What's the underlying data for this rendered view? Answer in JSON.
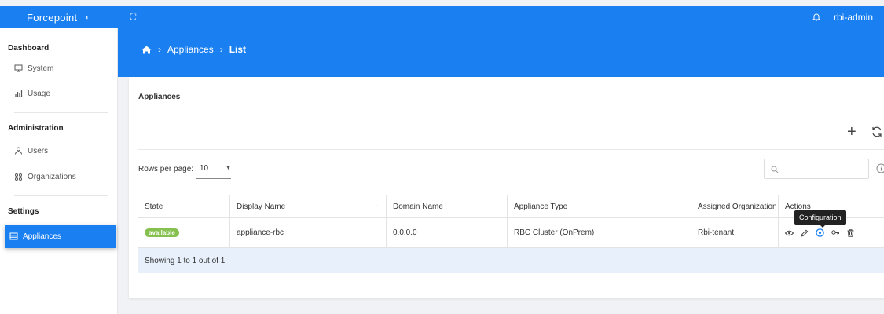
{
  "topbar": {
    "brand": "Forcepoint",
    "user": "rbi-admin"
  },
  "sidebar": {
    "sections": [
      {
        "heading": "Dashboard",
        "items": [
          {
            "label": "System",
            "icon": "monitor-icon"
          },
          {
            "label": "Usage",
            "icon": "bar-chart-icon"
          }
        ]
      },
      {
        "heading": "Administration",
        "items": [
          {
            "label": "Users",
            "icon": "user-icon"
          },
          {
            "label": "Organizations",
            "icon": "organizations-icon"
          }
        ]
      },
      {
        "heading": "Settings",
        "items": [
          {
            "label": "Appliances",
            "icon": "appliances-icon",
            "active": true
          }
        ]
      }
    ]
  },
  "breadcrumb": {
    "home_icon": "home-icon",
    "items": [
      "Appliances",
      "List"
    ]
  },
  "card": {
    "title": "Appliances"
  },
  "pagination": {
    "rows_label": "Rows per page:",
    "rows_value": "10"
  },
  "search": {
    "placeholder": ""
  },
  "table": {
    "columns": [
      "State",
      "Display Name",
      "Domain Name",
      "Appliance Type",
      "Assigned Organization",
      "Actions"
    ],
    "rows": [
      {
        "state": "available",
        "display_name": "appliance-rbc",
        "domain_name": "0.0.0.0",
        "appliance_type": "RBC Cluster (OnPrem)",
        "assigned_organization": "Rbi-tenant"
      }
    ],
    "footer": "Showing 1 to 1 out of 1"
  },
  "tooltip": "Configuration",
  "colors": {
    "primary": "#1a7ff0",
    "available": "#86c04f",
    "row_highlight": "#e7f0fb"
  }
}
